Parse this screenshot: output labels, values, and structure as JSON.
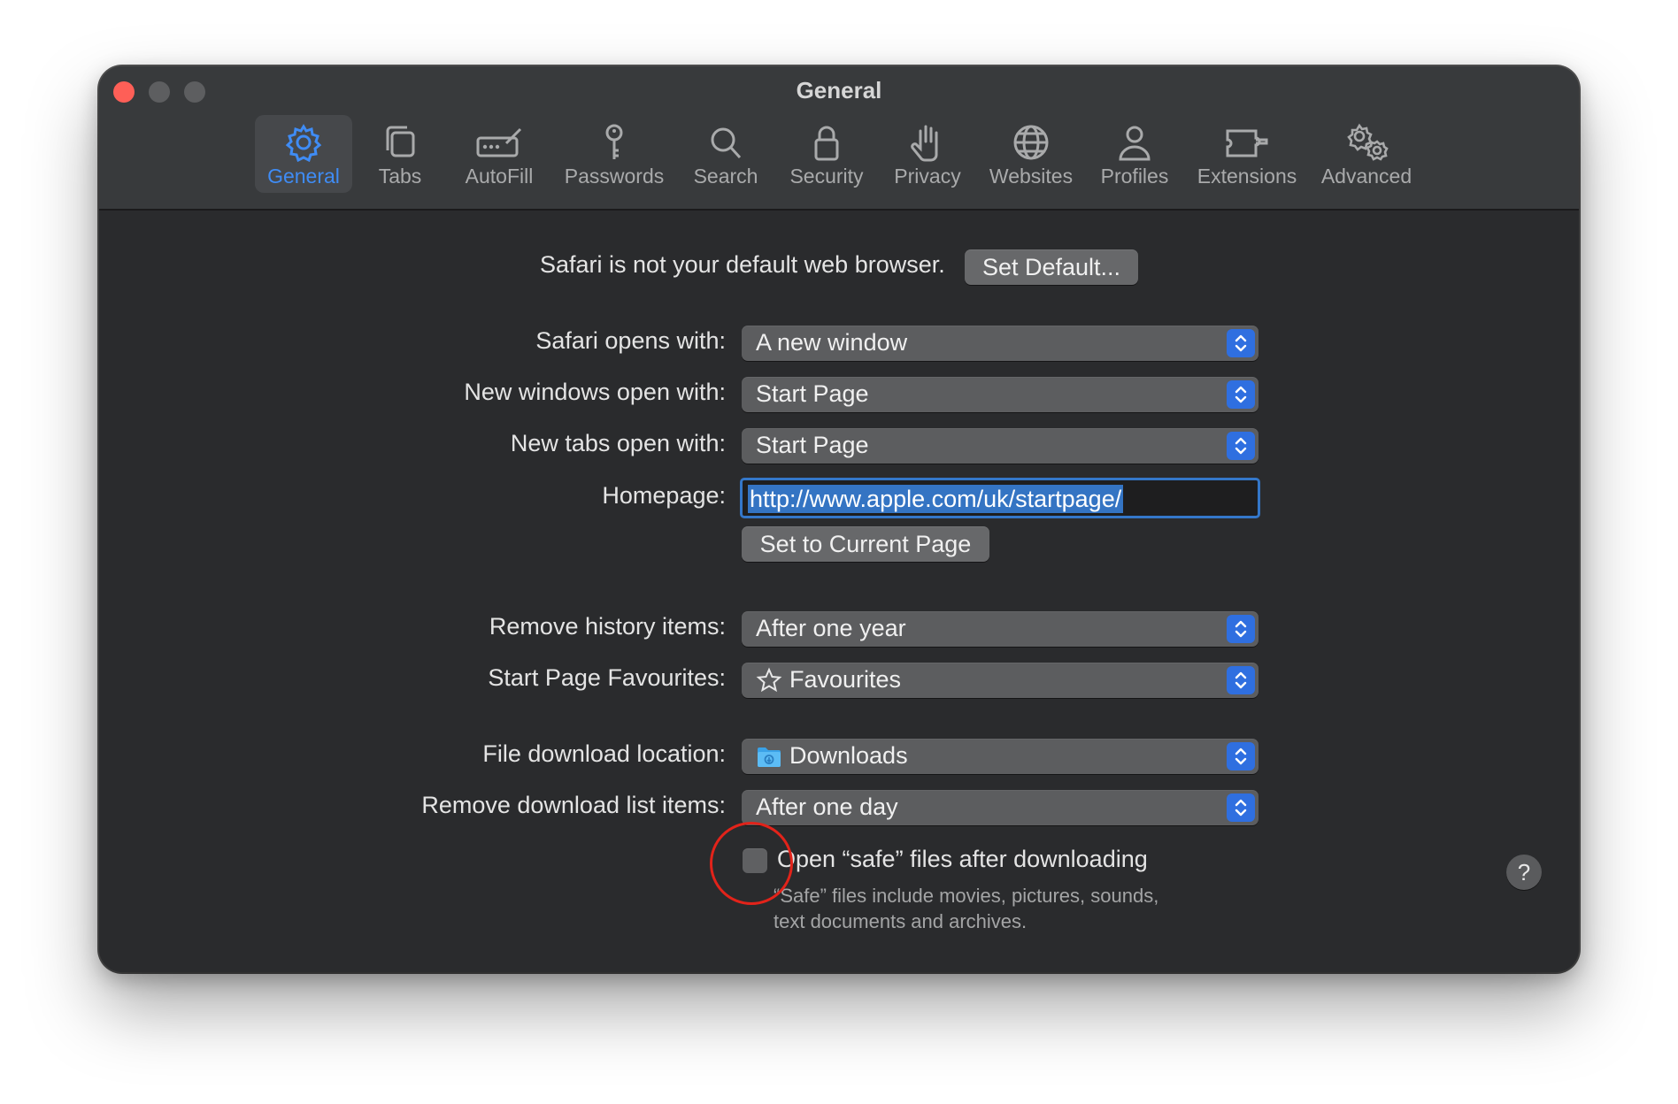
{
  "window": {
    "title": "General"
  },
  "toolbar": {
    "items": [
      {
        "label": "General",
        "icon": "gear-icon",
        "active": true
      },
      {
        "label": "Tabs",
        "icon": "tabs-icon"
      },
      {
        "label": "AutoFill",
        "icon": "autofill-icon"
      },
      {
        "label": "Passwords",
        "icon": "key-icon"
      },
      {
        "label": "Search",
        "icon": "search-icon"
      },
      {
        "label": "Security",
        "icon": "lock-icon"
      },
      {
        "label": "Privacy",
        "icon": "hand-icon"
      },
      {
        "label": "Websites",
        "icon": "globe-icon"
      },
      {
        "label": "Profiles",
        "icon": "person-icon"
      },
      {
        "label": "Extensions",
        "icon": "puzzle-icon"
      },
      {
        "label": "Advanced",
        "icon": "gears-icon"
      }
    ]
  },
  "general": {
    "default_browser_text": "Safari is not your default web browser.",
    "set_default_label": "Set Default...",
    "safari_opens_with": {
      "label": "Safari opens with:",
      "value": "A new window"
    },
    "new_windows_open_with": {
      "label": "New windows open with:",
      "value": "Start Page"
    },
    "new_tabs_open_with": {
      "label": "New tabs open with:",
      "value": "Start Page"
    },
    "homepage": {
      "label": "Homepage:",
      "value": "http://www.apple.com/uk/startpage/"
    },
    "set_current_page_label": "Set to Current Page",
    "remove_history_items": {
      "label": "Remove history items:",
      "value": "After one year"
    },
    "start_page_favourites": {
      "label": "Start Page Favourites:",
      "value": "Favourites"
    },
    "file_download_location": {
      "label": "File download location:",
      "value": "Downloads"
    },
    "remove_download_list_items": {
      "label": "Remove download list items:",
      "value": "After one day"
    },
    "open_safe_files": {
      "label": "Open “safe” files after downloading",
      "checked": false
    },
    "hint_line1": "“Safe” files include movies, pictures, sounds,",
    "hint_line2": "text documents and archives.",
    "help_label": "?"
  },
  "colors": {
    "accent": "#3f8cf5",
    "close_button": "#fe5f57",
    "highlight_circle": "#e2231a"
  }
}
